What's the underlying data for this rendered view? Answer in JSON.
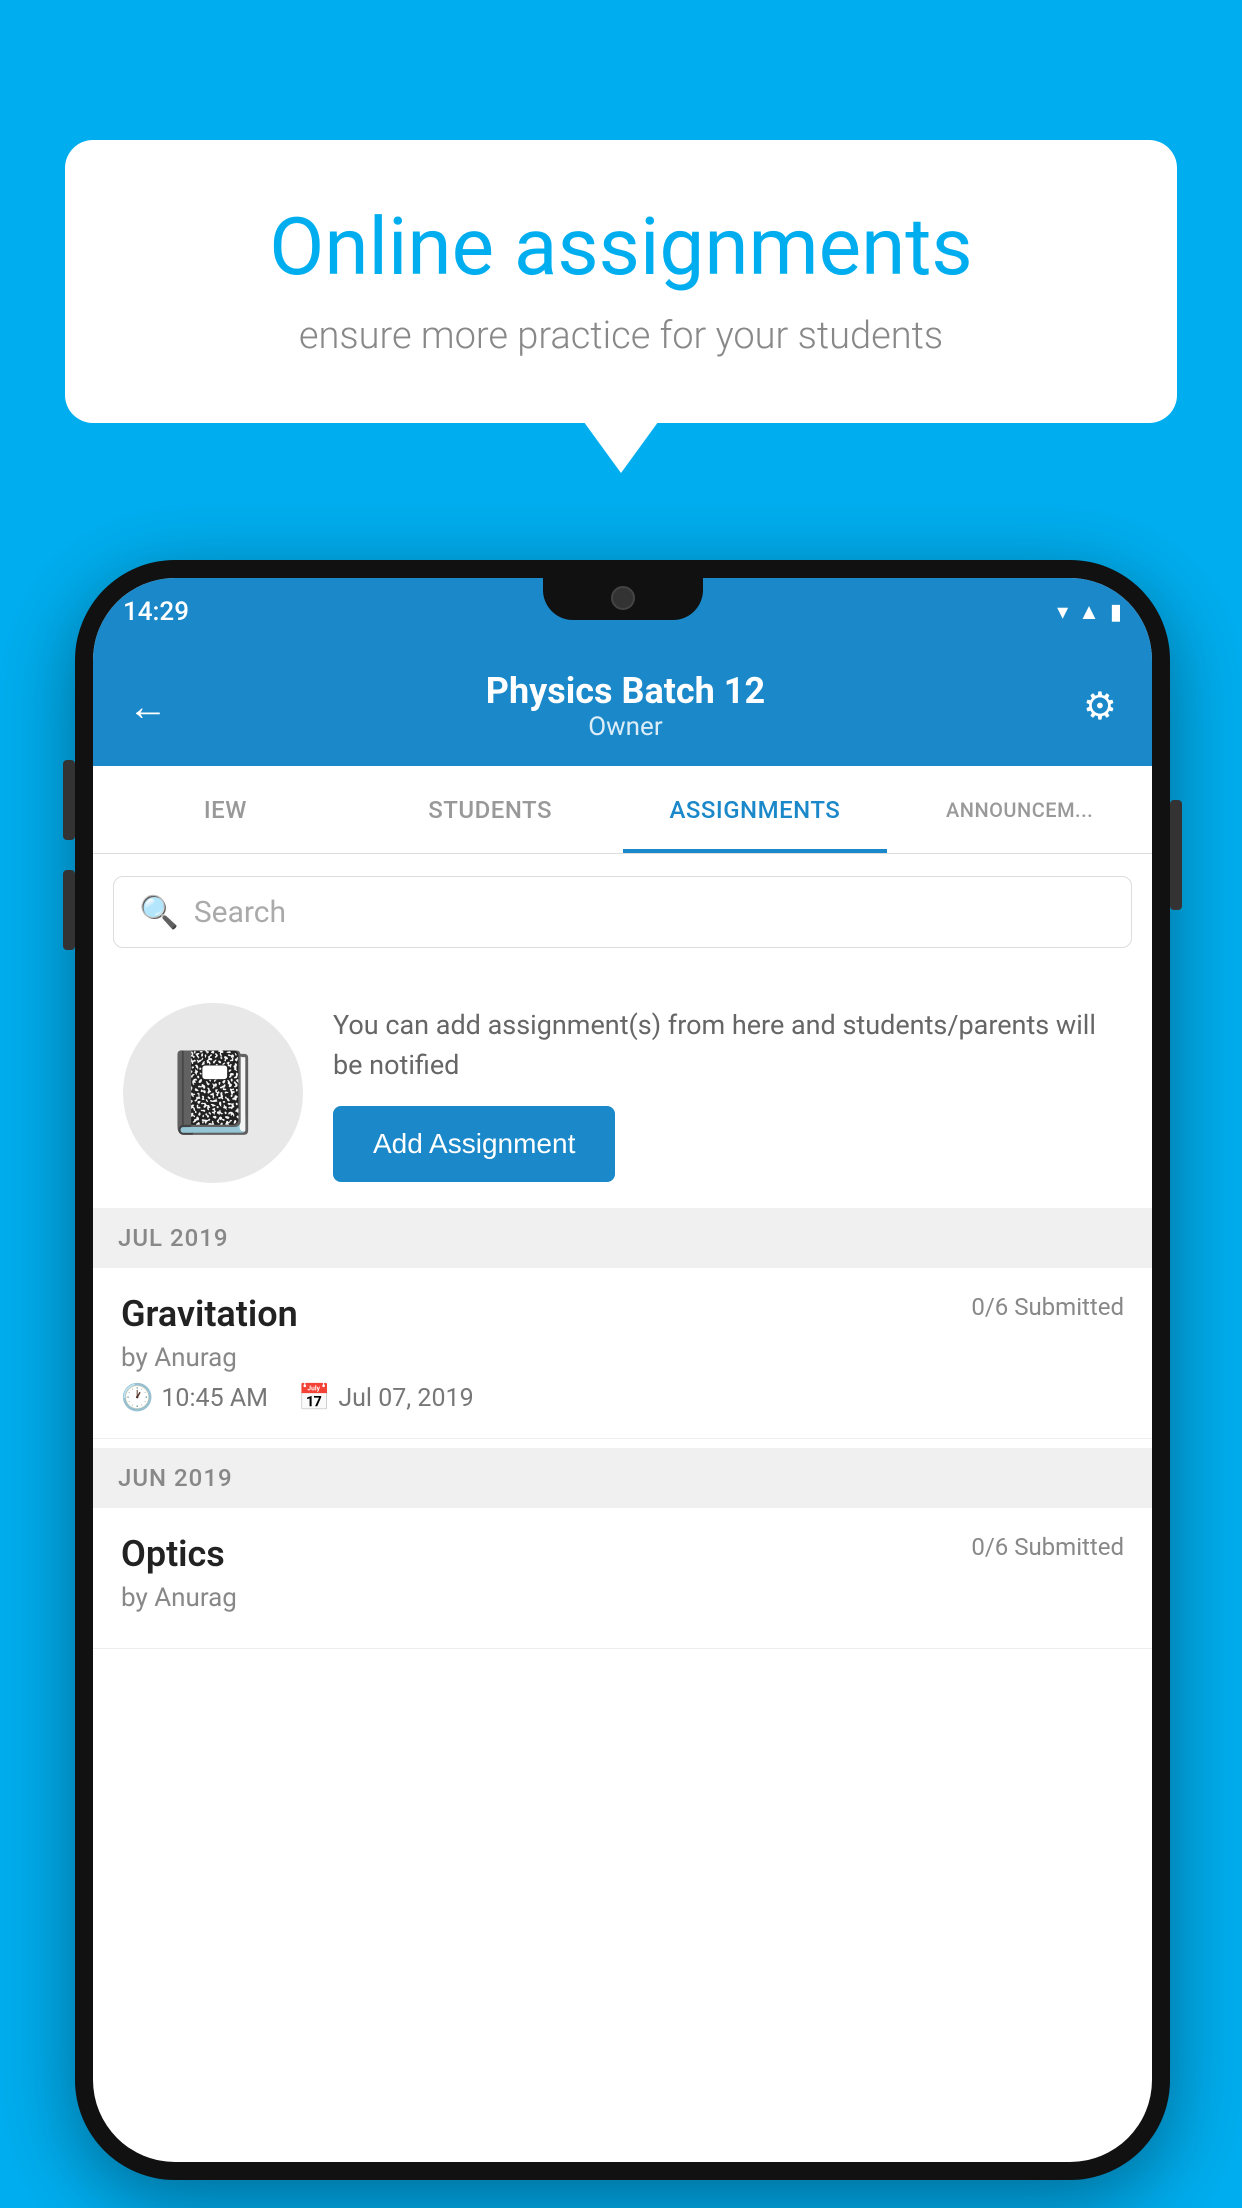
{
  "background_color": "#00AEEF",
  "speech_bubble": {
    "title": "Online assignments",
    "subtitle": "ensure more practice for your students"
  },
  "phone": {
    "status_bar": {
      "time": "14:29",
      "icons": [
        "wifi",
        "signal",
        "battery"
      ]
    },
    "app_bar": {
      "back_label": "←",
      "title": "Physics Batch 12",
      "subtitle": "Owner",
      "settings_label": "⚙"
    },
    "tabs": [
      {
        "label": "IEW",
        "active": false
      },
      {
        "label": "STUDENTS",
        "active": false
      },
      {
        "label": "ASSIGNMENTS",
        "active": true
      },
      {
        "label": "ANNOUNCEM...",
        "active": false
      }
    ],
    "search": {
      "placeholder": "Search"
    },
    "promo": {
      "description": "You can add assignment(s) from here and students/parents will be notified",
      "button_label": "Add Assignment"
    },
    "sections": [
      {
        "header": "JUL 2019",
        "assignments": [
          {
            "title": "Gravitation",
            "submitted": "0/6 Submitted",
            "author": "by Anurag",
            "time": "10:45 AM",
            "date": "Jul 07, 2019"
          }
        ]
      },
      {
        "header": "JUN 2019",
        "assignments": [
          {
            "title": "Optics",
            "submitted": "0/6 Submitted",
            "author": "by Anurag",
            "time": "",
            "date": ""
          }
        ]
      }
    ]
  }
}
